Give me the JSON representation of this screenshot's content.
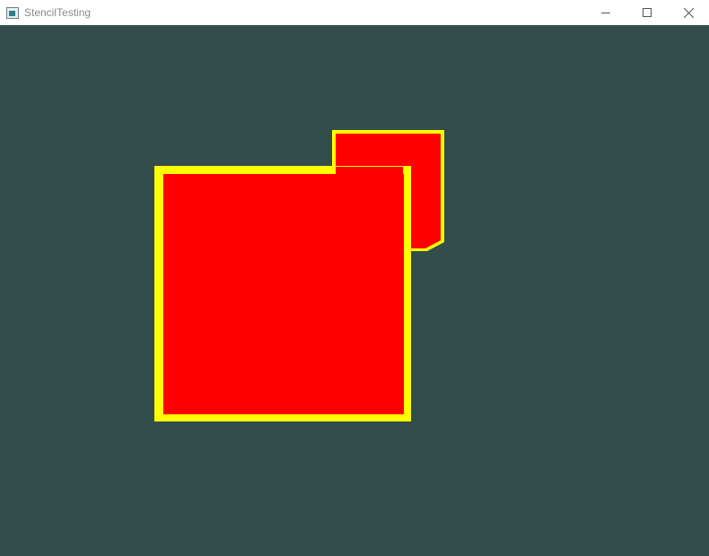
{
  "window": {
    "title": "StencilTesting",
    "controls": [
      "minimize-icon",
      "maximize-icon",
      "close-icon"
    ]
  },
  "scene": {
    "clear_color": "#334d4d",
    "fill_color": "#ff0000",
    "outline_color": "#ffff00"
  }
}
